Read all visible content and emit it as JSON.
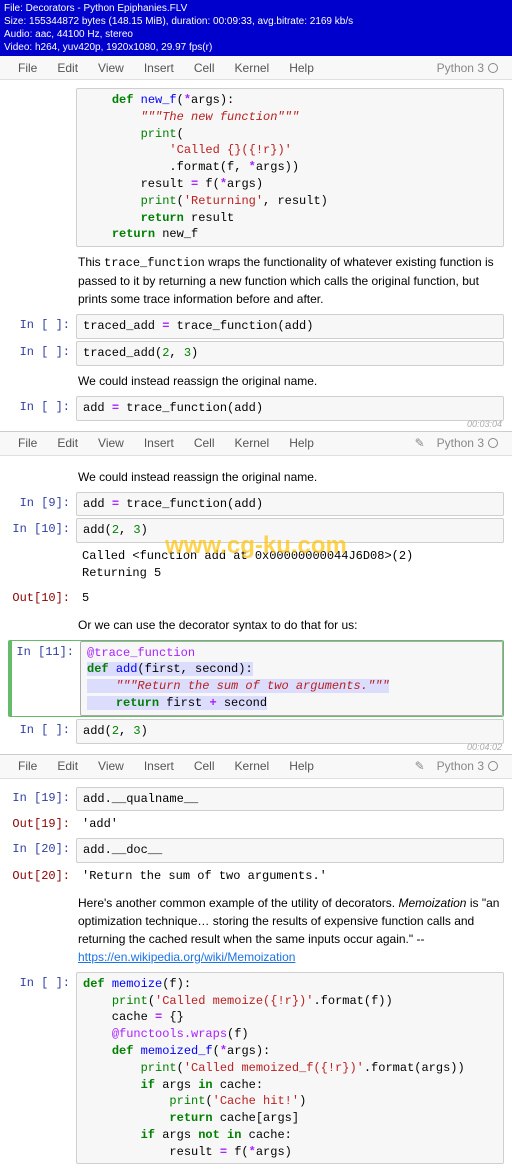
{
  "video_info": {
    "file": "File: Decorators - Python Epiphanies.FLV",
    "size": "Size: 155344872 bytes (148.15 MiB), duration: 00:09:33, avg.bitrate: 2169 kb/s",
    "audio": "Audio: aac, 44100 Hz, stereo",
    "video": "Video: h264, yuv420p, 1920x1080, 29.97 fps(r)"
  },
  "watermark": "www.cg-ku.com",
  "menubar": {
    "file": "File",
    "edit": "Edit",
    "view": "View",
    "insert": "Insert",
    "cell": "Cell",
    "kernel": "Kernel",
    "help": "Help",
    "kernel_info": "Python 3"
  },
  "timestamps": {
    "s1": "00:03:04",
    "s2": "00:04:02"
  },
  "section1": {
    "code_top": {
      "l1": "def new_f(*args):",
      "l2": "    \"\"\"The new function\"\"\"",
      "l3": "    print(",
      "l4": "        'Called {}({!r})'",
      "l5": "        .format(f, *args))",
      "l6": "    result = f(*args)",
      "l7": "    print('Returning', result)",
      "l8": "    return result",
      "l9": "return new_f"
    },
    "md1_a": "This ",
    "md1_mono": "trace_function",
    "md1_b": " wraps the functionality of whatever existing function is passed to it by returning a new function which calls the original function, but prints some trace information before and after.",
    "code2": "traced_add = trace_function(add)",
    "code3": "traced_add(2, 3)",
    "md2": "We could instead reassign the original name.",
    "code4": "add = trace_function(add)"
  },
  "section2": {
    "md1": "We could instead reassign the original name.",
    "p9": "In [9]:",
    "code9": "add = trace_function(add)",
    "p10": "In [10]:",
    "code10": "add(2, 3)",
    "out10a": "Called <function add at 0x00000000044J6D08>(2)\nReturning 5",
    "p10o": "Out[10]:",
    "out10b": "5",
    "md2": "Or we can use the decorator syntax to do that for us:",
    "p11": "In [11]:",
    "c11_l1": "@trace_function",
    "c11_l2": "def add(first, second):",
    "c11_l3": "    \"\"\"Return the sum of two arguments.\"\"\"",
    "c11_l4": "    return first + second",
    "p12": "In [ ]:",
    "code12": "add(2, 3)"
  },
  "section3": {
    "p19": "In [19]:",
    "code19": "add.__qualname__",
    "p19o": "Out[19]:",
    "out19": "'add'",
    "p20": "In [20]:",
    "code20": "add.__doc__",
    "p20o": "Out[20]:",
    "out20": "'Return the sum of two arguments.'",
    "md_a": "Here's another common example of the utility of decorators. ",
    "md_em": "Memoization",
    "md_b": " is \"an optimization technique… storing the results of expensive function calls and returning the cached result when the same inputs occur again.\" -- ",
    "md_link": "https://en.wikipedia.org/wiki/Memoization",
    "pmem": "In [ ]:",
    "mem": {
      "l1": "def memoize(f):",
      "l2": "    print('Called memoize({!r})'.format(f))",
      "l3": "    cache = {}",
      "l4": "    @functools.wraps(f)",
      "l5": "    def memoized_f(*args):",
      "l6": "        print('Called memoized_f({!r})'.format(args))",
      "l7": "        if args in cache:",
      "l8": "            print('Cache hit!')",
      "l9": "            return cache[args]",
      "l10": "        if args not in cache:",
      "l11": "            result = f(*args)"
    }
  }
}
